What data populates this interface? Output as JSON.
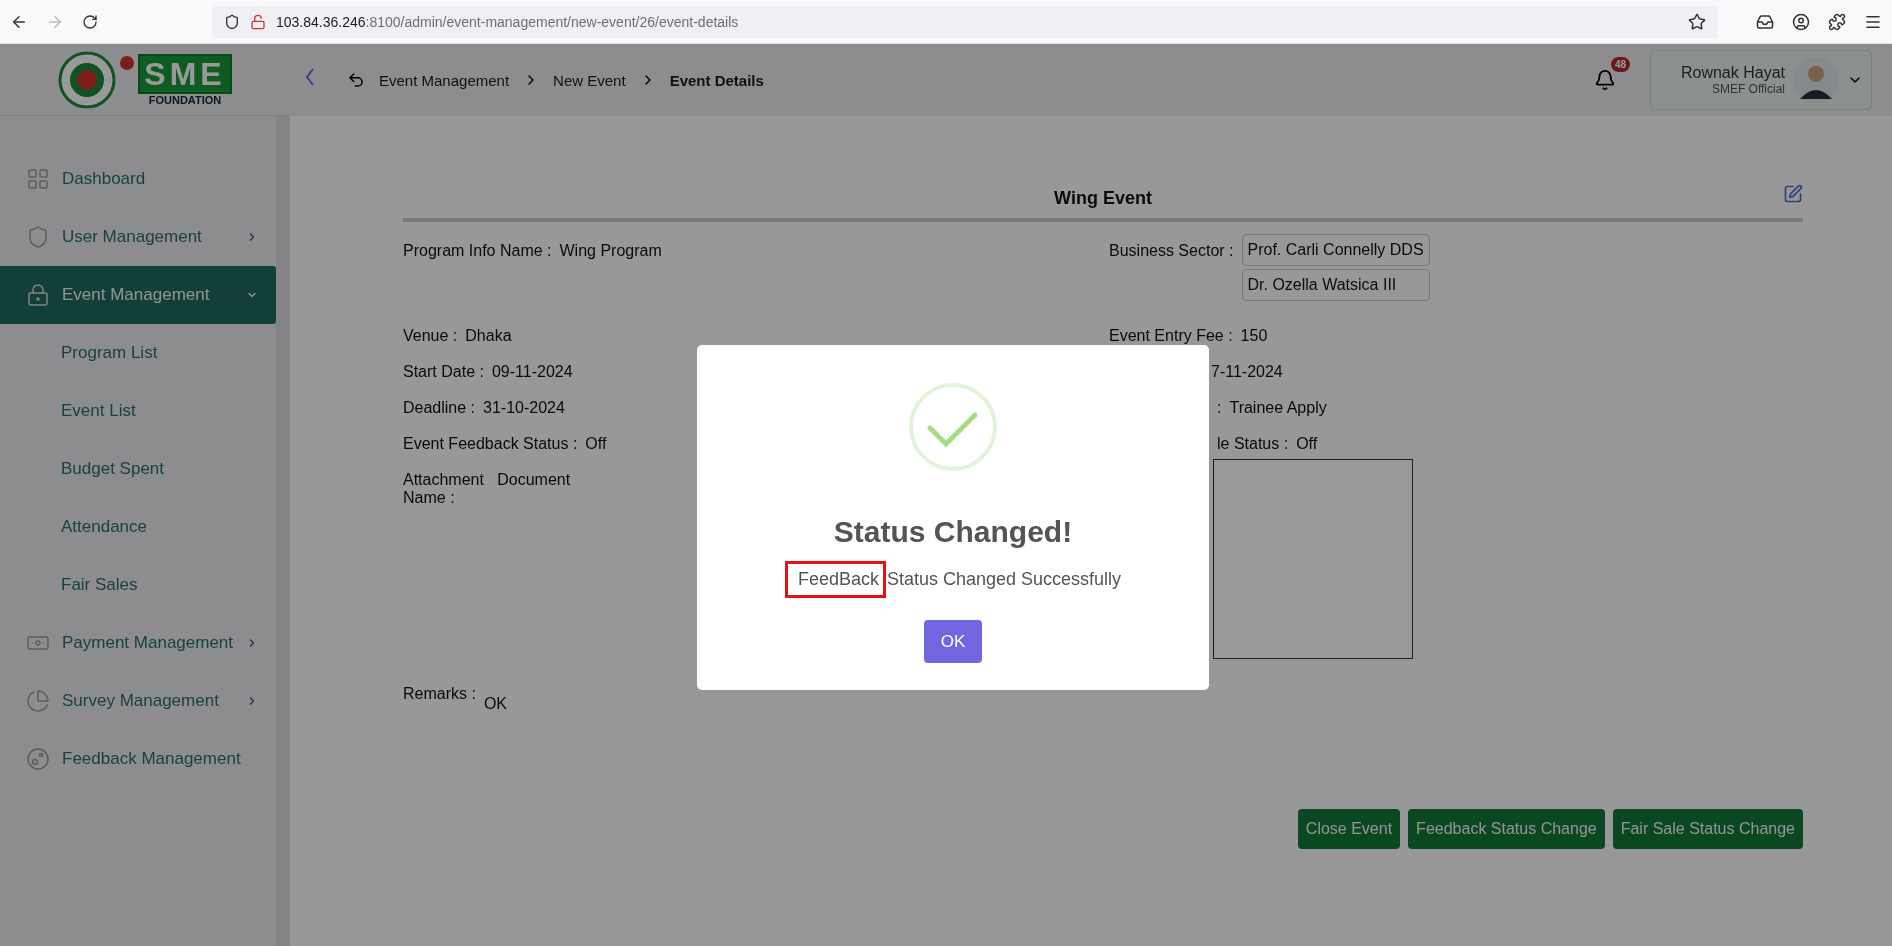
{
  "browser": {
    "url_host": "103.84.36.246",
    "url_path": ":8100/admin/event-management/new-event/26/event-details",
    "forward_disabled": true
  },
  "logo": {
    "letters": "SME",
    "subtitle": "FOUNDATION"
  },
  "header": {
    "breadcrumb": [
      {
        "label": "Event Management",
        "current": false
      },
      {
        "label": "New Event",
        "current": false
      },
      {
        "label": "Event Details",
        "current": true
      }
    ],
    "notifications": "48",
    "user": {
      "name": "Rownak Hayat",
      "role": "SMEF Official"
    }
  },
  "sidebar": {
    "items": [
      {
        "label": "Dashboard",
        "kind": "grid",
        "selected": false
      },
      {
        "label": "User Management",
        "kind": "shield",
        "selected": false,
        "expanded": false
      },
      {
        "label": "Event Management",
        "kind": "lock",
        "selected": true,
        "expanded": true,
        "children": [
          {
            "label": "Program List"
          },
          {
            "label": "Event List"
          },
          {
            "label": "Budget Spent"
          },
          {
            "label": "Attendance"
          },
          {
            "label": "Fair Sales"
          }
        ]
      },
      {
        "label": "Payment Management",
        "kind": "money",
        "selected": false,
        "expanded": false
      },
      {
        "label": "Survey Management",
        "kind": "pie",
        "selected": false,
        "expanded": false
      },
      {
        "label": "Feedback Management",
        "kind": "feedback",
        "selected": false
      }
    ]
  },
  "event": {
    "title": "Wing Event",
    "rows": [
      {
        "left": {
          "label": "Program Info Name :",
          "value": "Wing Program"
        },
        "right": {
          "kind": "chips",
          "label": "Business Sector :",
          "chips": [
            "Prof. Carli Connelly DDS",
            "Dr. Ozella Watsica III"
          ]
        }
      },
      {
        "left": {
          "label": "Venue :",
          "value": "Dhaka"
        },
        "right": {
          "kind": "field",
          "label": "Event Entry Fee :",
          "value": "150"
        }
      },
      {
        "left": {
          "label": "Start Date :",
          "value": "09-11-2024"
        },
        "right": {
          "kind": "partial",
          "value": "7-11-2024"
        }
      },
      {
        "left": {
          "label": "Deadline :",
          "value": "31-10-2024"
        },
        "right": {
          "kind": "partial",
          "label": ":",
          "value": "Trainee Apply"
        }
      },
      {
        "left": {
          "label": "Event Feedback Status :",
          "value": "Off"
        },
        "right": {
          "kind": "partial",
          "label": "le Status :",
          "value": "Off"
        }
      },
      {
        "left": {
          "label": "Attachment   Document Name :"
        },
        "right": {
          "kind": "preview"
        }
      }
    ],
    "remarks": {
      "label": "Remarks :",
      "value": "OK"
    },
    "buttons": [
      "Close Event",
      "Feedback Status Change",
      "Fair Sale Status Change"
    ]
  },
  "modal": {
    "title": "Status Changed!",
    "highlight": "FeedBack",
    "message": "Status Changed Successfully",
    "button": "OK"
  }
}
